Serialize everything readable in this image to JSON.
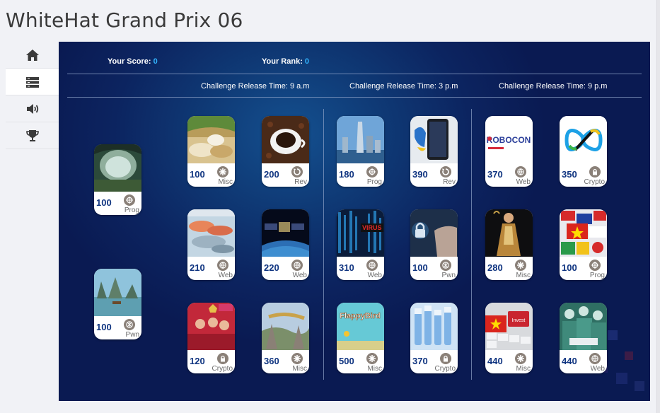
{
  "header": {
    "title": "WhiteHat Grand Prix 06"
  },
  "sidebar": {
    "items": [
      {
        "icon": "home-icon",
        "active": false
      },
      {
        "icon": "server-icon",
        "active": true
      },
      {
        "icon": "volume-icon",
        "active": false
      },
      {
        "icon": "trophy-icon",
        "active": false
      }
    ]
  },
  "board": {
    "score_label": "Your Score:",
    "score_value": "0",
    "rank_label": "Your Rank:",
    "rank_value": "0",
    "releases": [
      "Challenge Release Time: 9 a.m",
      "Challenge Release Time: 3 p.m",
      "Challenge Release Time: 9 p.m"
    ]
  },
  "challenges": [
    {
      "points": "100",
      "category": "Prog",
      "image": "cave"
    },
    {
      "points": "100",
      "category": "Pwn",
      "image": "bay"
    },
    {
      "points": "100",
      "category": "Misc",
      "image": "rice"
    },
    {
      "points": "200",
      "category": "Rev",
      "image": "coffee"
    },
    {
      "points": "210",
      "category": "Web",
      "image": "seafood"
    },
    {
      "points": "220",
      "category": "Web",
      "image": "satellite"
    },
    {
      "points": "120",
      "category": "Crypto",
      "image": "football"
    },
    {
      "points": "360",
      "category": "Misc",
      "image": "golden-bridge"
    },
    {
      "points": "180",
      "category": "Prog",
      "image": "skyline"
    },
    {
      "points": "390",
      "category": "Rev",
      "image": "phone-parrot"
    },
    {
      "points": "310",
      "category": "Web",
      "image": "virus"
    },
    {
      "points": "100",
      "category": "Pwn",
      "image": "lock-hand"
    },
    {
      "points": "500",
      "category": "Misc",
      "image": "flappybird",
      "image_text": "FlappyBird"
    },
    {
      "points": "370",
      "category": "Crypto",
      "image": "vials"
    },
    {
      "points": "370",
      "category": "Web",
      "image": "robocon",
      "image_text": "ROBOCON"
    },
    {
      "points": "350",
      "category": "Crypto",
      "image": "olympiad-logo"
    },
    {
      "points": "280",
      "category": "Misc",
      "image": "ao-dai"
    },
    {
      "points": "100",
      "category": "Prog",
      "image": "flags"
    },
    {
      "points": "440",
      "category": "Misc",
      "image": "keyboard-flag",
      "image_text": "Invest"
    },
    {
      "points": "440",
      "category": "Web",
      "image": "surgeons"
    }
  ],
  "colors": {
    "accent": "#33b5ff",
    "points": "#0f3480",
    "board": "#0c2460"
  }
}
